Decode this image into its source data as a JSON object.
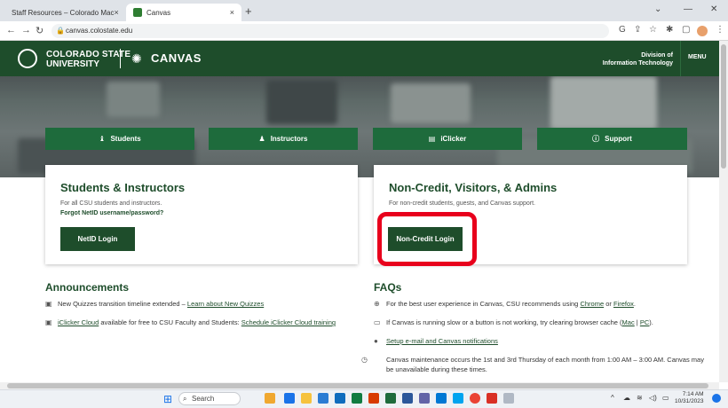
{
  "browser": {
    "tabs": [
      {
        "title": "Staff Resources – Colorado Mac",
        "close": "×"
      },
      {
        "title": "Canvas",
        "close": "×"
      }
    ],
    "new_tab": "+",
    "url": "canvas.colostate.edu",
    "nav_icons": [
      "back-icon",
      "forward-icon",
      "reload-icon"
    ],
    "right_icons": [
      "google-icon",
      "share-icon",
      "star-icon",
      "extensions-icon",
      "sidepanel-icon",
      "profile-icon",
      "kebab-icon"
    ]
  },
  "header": {
    "csu_line1": "COLORADO STATE",
    "csu_line2": "UNIVERSITY",
    "canvas": "CANVAS",
    "division_line1": "Division of",
    "division_line2": "Information Technology",
    "menu": "MENU"
  },
  "roles": [
    {
      "label": "Students",
      "icon": "student-icon"
    },
    {
      "label": "Instructors",
      "icon": "instructor-icon"
    },
    {
      "label": "iClicker",
      "icon": "iclicker-icon"
    },
    {
      "label": "Support",
      "icon": "info-icon"
    }
  ],
  "cards": {
    "left": {
      "title": "Students & Instructors",
      "subtitle": "For all CSU students and instructors.",
      "forgot": "Forgot NetID username/password?",
      "button": "NetID Login"
    },
    "right": {
      "title": "Non-Credit, Visitors, & Admins",
      "subtitle": "For non-credit students, guests, and Canvas support.",
      "button": "Non-Credit Login"
    }
  },
  "announcements": {
    "title": "Announcements",
    "items": [
      {
        "text": "New Quizzes transition timeline extended – ",
        "link": "Learn about New Quizzes"
      },
      {
        "link_first": "iClicker Cloud",
        "text": " available for free to CSU Faculty and Students: ",
        "link": "Schedule iClicker Cloud training"
      }
    ]
  },
  "faqs": {
    "title": "FAQs",
    "items": [
      {
        "text": "For the best user experience in Canvas, CSU recommends using ",
        "link1": "Chrome",
        "mid": " or ",
        "link2": "Firefox",
        "end": "."
      },
      {
        "text": "If Canvas is running slow or a button is not working, try clearing browser cache (",
        "link1": "Mac",
        "mid": " | ",
        "link2": "PC",
        "end": ")."
      },
      {
        "link": "Setup e-mail and Canvas notifications"
      },
      {
        "text": "Canvas maintenance occurs the 1st and 3rd Thursday of each month from 1:00 AM – 3:00 AM. Canvas may be unavailable during these times."
      }
    ]
  },
  "taskbar": {
    "search_placeholder": "Search",
    "time": "7:14 AM",
    "date": "10/31/2023"
  }
}
